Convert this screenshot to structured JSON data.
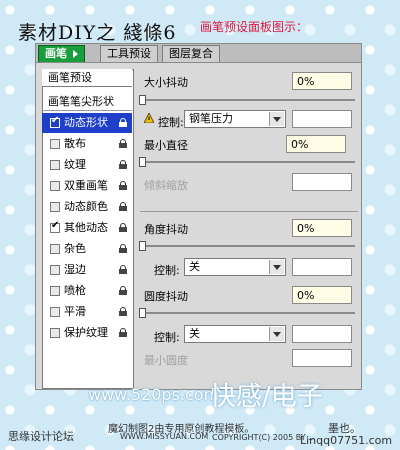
{
  "title": "素材DIY之 綫條6",
  "caption": "画笔预设面板图示：",
  "tabs": [
    {
      "label": "画笔",
      "active": true
    },
    {
      "label": "工具预设",
      "active": false
    },
    {
      "label": "图层复合",
      "active": false
    }
  ],
  "left_panel": {
    "preset_label": "画笔预设",
    "tip_label": "画笔笔尖形状",
    "options": [
      {
        "label": "动态形状",
        "checked": true,
        "selected": true
      },
      {
        "label": "散布",
        "checked": false,
        "selected": false
      },
      {
        "label": "纹理",
        "checked": false,
        "selected": false
      },
      {
        "label": "双重画笔",
        "checked": false,
        "selected": false
      },
      {
        "label": "动态颜色",
        "checked": false,
        "selected": false
      },
      {
        "label": "其他动态",
        "checked": true,
        "selected": false
      },
      {
        "label": "杂色",
        "checked": false,
        "selected": false
      },
      {
        "label": "湿边",
        "checked": false,
        "selected": false
      },
      {
        "label": "喷枪",
        "checked": false,
        "selected": false
      },
      {
        "label": "平滑",
        "checked": false,
        "selected": false
      },
      {
        "label": "保护纹理",
        "checked": false,
        "selected": false
      }
    ]
  },
  "right_panel": {
    "size_jitter_label": "大小抖动",
    "size_jitter_value": "0%",
    "control_label": "控制:",
    "control_value_1": "钢笔压力",
    "min_diameter_label": "最小直径",
    "min_diameter_value": "0%",
    "tilt_scale_label": "倾斜缩放",
    "angle_jitter_label": "角度抖动",
    "angle_jitter_value": "0%",
    "control_value_2": "关",
    "roundness_jitter_label": "圆度抖动",
    "roundness_jitter_value": "0%",
    "control_value_3": "关",
    "min_roundness_label": "最小圆度"
  },
  "watermark": {
    "site": "www.520ps.com",
    "logo_text": "快感/电子",
    "forum": "思缘设计论坛",
    "notice": "魔幻制图2由专用原创教程模板。",
    "sub_site": "WWW.MISSYUAN.COM",
    "copyright": "COPYRIGHT(C) 2005 BY ...",
    "author": "墨也。",
    "qq": "Linqq07751.com"
  },
  "colors": {
    "background": "#cfe9f7",
    "active_tab": "#1a9d3b",
    "selected_option": "#1e3fc8",
    "caption": "#e0173b"
  }
}
